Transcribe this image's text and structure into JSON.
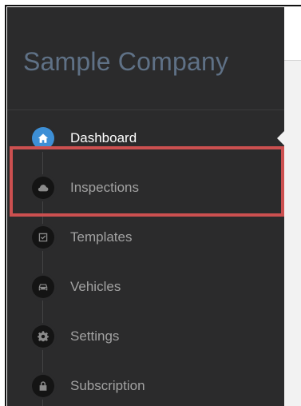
{
  "brand": {
    "name": "Sample Company"
  },
  "nav": {
    "items": [
      {
        "label": "Dashboard",
        "icon": "home-icon",
        "active": true
      },
      {
        "label": "Inspections",
        "icon": "cloud-icon",
        "active": false
      },
      {
        "label": "Templates",
        "icon": "checkbox-icon",
        "active": false
      },
      {
        "label": "Vehicles",
        "icon": "car-icon",
        "active": false
      },
      {
        "label": "Settings",
        "icon": "gear-icon",
        "active": false
      },
      {
        "label": "Subscription",
        "icon": "lock-icon",
        "active": false
      }
    ]
  },
  "colors": {
    "sidebar_bg": "#2b2b2c",
    "brand_text": "#5f7186",
    "active_icon_bg": "#3d8fd6",
    "highlight": "#cc5050"
  }
}
